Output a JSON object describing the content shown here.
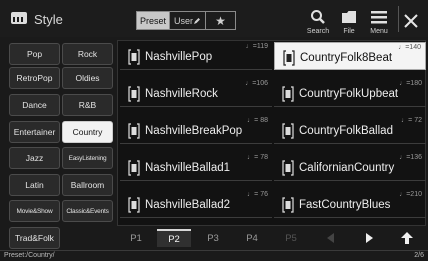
{
  "header": {
    "title": "Style",
    "tabs": {
      "preset": "Preset",
      "user": "User"
    },
    "tools": {
      "search": "Search",
      "file": "File",
      "menu": "Menu"
    }
  },
  "categories": [
    [
      "Pop",
      "Rock"
    ],
    [
      "RetroPop",
      "Oldies"
    ],
    [
      "Dance",
      "R&B"
    ],
    [
      "Entertainer",
      "Country"
    ],
    [
      "Jazz",
      "EasyListening"
    ],
    [
      "Latin",
      "Ballroom"
    ],
    [
      "Movie&Show",
      "Classic&Events"
    ],
    [
      "Trad&Folk"
    ]
  ],
  "styles": {
    "left": [
      {
        "name": "NashvillePop",
        "tempo": "♩=119"
      },
      {
        "name": "NashvilleRock",
        "tempo": "♩=106"
      },
      {
        "name": "NashvilleBreakPop",
        "tempo": "♩= 88"
      },
      {
        "name": "NashvilleBallad1",
        "tempo": "♩= 78"
      },
      {
        "name": "NashvilleBallad2",
        "tempo": "♩= 76"
      }
    ],
    "right": [
      {
        "name": "CountryFolk8Beat",
        "tempo": "♩=140"
      },
      {
        "name": "CountryFolkUpbeat",
        "tempo": "♩=180"
      },
      {
        "name": "CountryFolkBallad",
        "tempo": "♩= 72"
      },
      {
        "name": "CalifornianCountry",
        "tempo": "♩=136"
      },
      {
        "name": "FastCountryBlues",
        "tempo": "♩=210"
      }
    ]
  },
  "pages": [
    "P1",
    "P2",
    "P3",
    "P4",
    "P5"
  ],
  "status": {
    "path": "Preset:/Country/",
    "page": "2/6"
  }
}
